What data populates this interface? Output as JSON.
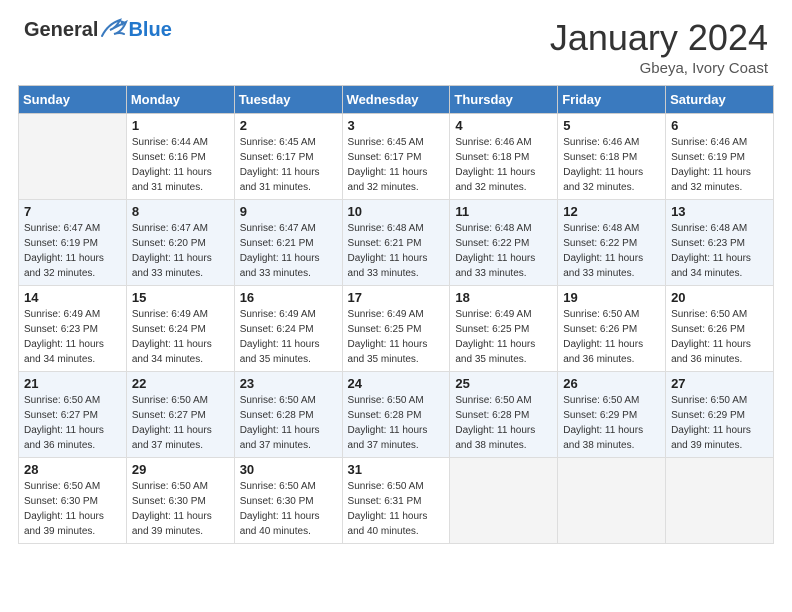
{
  "header": {
    "logo_general": "General",
    "logo_blue": "Blue",
    "month_title": "January 2024",
    "location": "Gbeya, Ivory Coast"
  },
  "weekdays": [
    "Sunday",
    "Monday",
    "Tuesday",
    "Wednesday",
    "Thursday",
    "Friday",
    "Saturday"
  ],
  "weeks": [
    [
      {
        "day": "",
        "info": ""
      },
      {
        "day": "1",
        "info": "Sunrise: 6:44 AM\nSunset: 6:16 PM\nDaylight: 11 hours\nand 31 minutes."
      },
      {
        "day": "2",
        "info": "Sunrise: 6:45 AM\nSunset: 6:17 PM\nDaylight: 11 hours\nand 31 minutes."
      },
      {
        "day": "3",
        "info": "Sunrise: 6:45 AM\nSunset: 6:17 PM\nDaylight: 11 hours\nand 32 minutes."
      },
      {
        "day": "4",
        "info": "Sunrise: 6:46 AM\nSunset: 6:18 PM\nDaylight: 11 hours\nand 32 minutes."
      },
      {
        "day": "5",
        "info": "Sunrise: 6:46 AM\nSunset: 6:18 PM\nDaylight: 11 hours\nand 32 minutes."
      },
      {
        "day": "6",
        "info": "Sunrise: 6:46 AM\nSunset: 6:19 PM\nDaylight: 11 hours\nand 32 minutes."
      }
    ],
    [
      {
        "day": "7",
        "info": "Sunrise: 6:47 AM\nSunset: 6:19 PM\nDaylight: 11 hours\nand 32 minutes."
      },
      {
        "day": "8",
        "info": "Sunrise: 6:47 AM\nSunset: 6:20 PM\nDaylight: 11 hours\nand 33 minutes."
      },
      {
        "day": "9",
        "info": "Sunrise: 6:47 AM\nSunset: 6:21 PM\nDaylight: 11 hours\nand 33 minutes."
      },
      {
        "day": "10",
        "info": "Sunrise: 6:48 AM\nSunset: 6:21 PM\nDaylight: 11 hours\nand 33 minutes."
      },
      {
        "day": "11",
        "info": "Sunrise: 6:48 AM\nSunset: 6:22 PM\nDaylight: 11 hours\nand 33 minutes."
      },
      {
        "day": "12",
        "info": "Sunrise: 6:48 AM\nSunset: 6:22 PM\nDaylight: 11 hours\nand 33 minutes."
      },
      {
        "day": "13",
        "info": "Sunrise: 6:48 AM\nSunset: 6:23 PM\nDaylight: 11 hours\nand 34 minutes."
      }
    ],
    [
      {
        "day": "14",
        "info": "Sunrise: 6:49 AM\nSunset: 6:23 PM\nDaylight: 11 hours\nand 34 minutes."
      },
      {
        "day": "15",
        "info": "Sunrise: 6:49 AM\nSunset: 6:24 PM\nDaylight: 11 hours\nand 34 minutes."
      },
      {
        "day": "16",
        "info": "Sunrise: 6:49 AM\nSunset: 6:24 PM\nDaylight: 11 hours\nand 35 minutes."
      },
      {
        "day": "17",
        "info": "Sunrise: 6:49 AM\nSunset: 6:25 PM\nDaylight: 11 hours\nand 35 minutes."
      },
      {
        "day": "18",
        "info": "Sunrise: 6:49 AM\nSunset: 6:25 PM\nDaylight: 11 hours\nand 35 minutes."
      },
      {
        "day": "19",
        "info": "Sunrise: 6:50 AM\nSunset: 6:26 PM\nDaylight: 11 hours\nand 36 minutes."
      },
      {
        "day": "20",
        "info": "Sunrise: 6:50 AM\nSunset: 6:26 PM\nDaylight: 11 hours\nand 36 minutes."
      }
    ],
    [
      {
        "day": "21",
        "info": "Sunrise: 6:50 AM\nSunset: 6:27 PM\nDaylight: 11 hours\nand 36 minutes."
      },
      {
        "day": "22",
        "info": "Sunrise: 6:50 AM\nSunset: 6:27 PM\nDaylight: 11 hours\nand 37 minutes."
      },
      {
        "day": "23",
        "info": "Sunrise: 6:50 AM\nSunset: 6:28 PM\nDaylight: 11 hours\nand 37 minutes."
      },
      {
        "day": "24",
        "info": "Sunrise: 6:50 AM\nSunset: 6:28 PM\nDaylight: 11 hours\nand 37 minutes."
      },
      {
        "day": "25",
        "info": "Sunrise: 6:50 AM\nSunset: 6:28 PM\nDaylight: 11 hours\nand 38 minutes."
      },
      {
        "day": "26",
        "info": "Sunrise: 6:50 AM\nSunset: 6:29 PM\nDaylight: 11 hours\nand 38 minutes."
      },
      {
        "day": "27",
        "info": "Sunrise: 6:50 AM\nSunset: 6:29 PM\nDaylight: 11 hours\nand 39 minutes."
      }
    ],
    [
      {
        "day": "28",
        "info": "Sunrise: 6:50 AM\nSunset: 6:30 PM\nDaylight: 11 hours\nand 39 minutes."
      },
      {
        "day": "29",
        "info": "Sunrise: 6:50 AM\nSunset: 6:30 PM\nDaylight: 11 hours\nand 39 minutes."
      },
      {
        "day": "30",
        "info": "Sunrise: 6:50 AM\nSunset: 6:30 PM\nDaylight: 11 hours\nand 40 minutes."
      },
      {
        "day": "31",
        "info": "Sunrise: 6:50 AM\nSunset: 6:31 PM\nDaylight: 11 hours\nand 40 minutes."
      },
      {
        "day": "",
        "info": ""
      },
      {
        "day": "",
        "info": ""
      },
      {
        "day": "",
        "info": ""
      }
    ]
  ]
}
